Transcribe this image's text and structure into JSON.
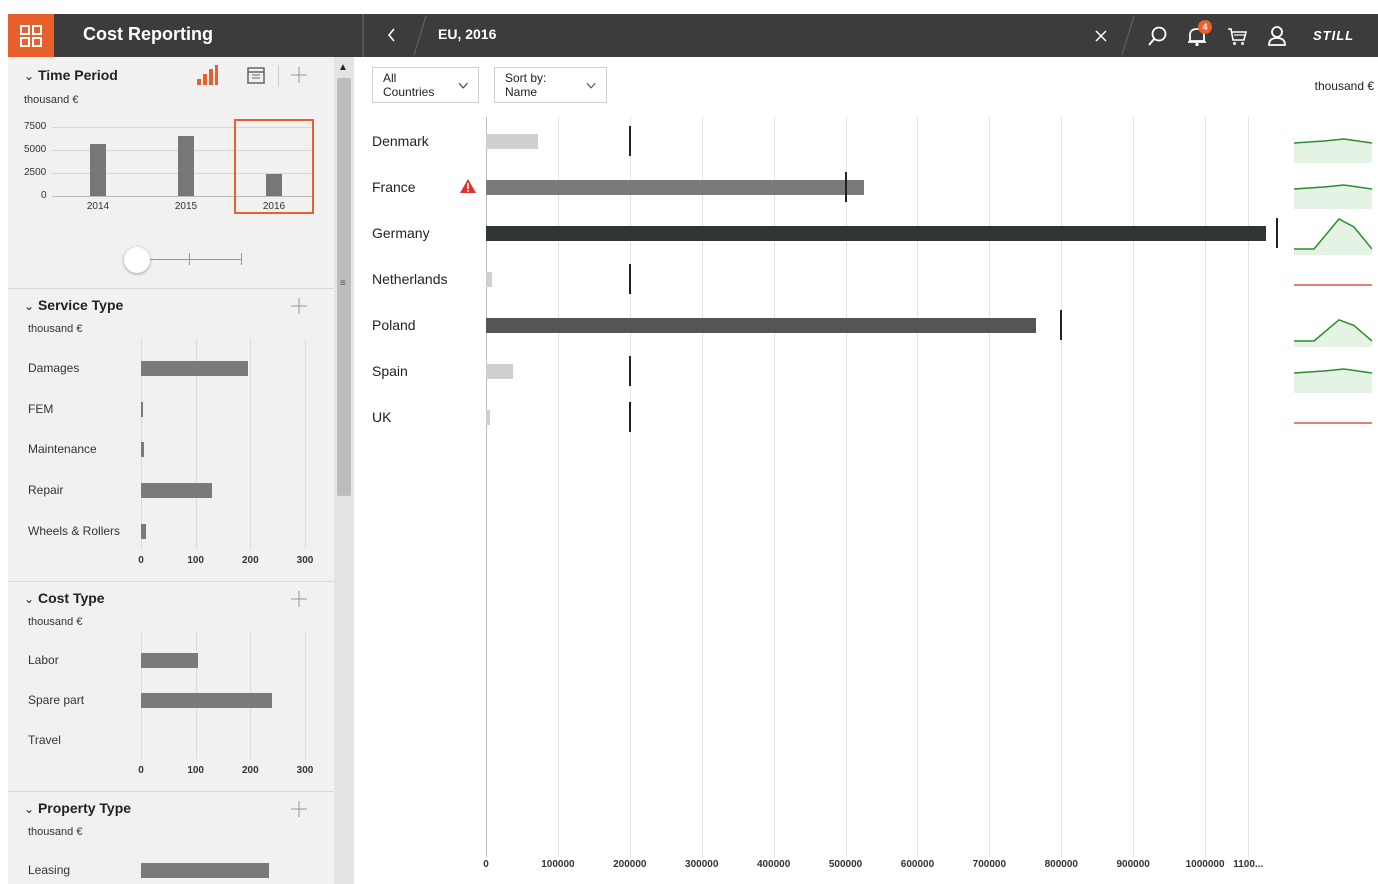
{
  "header": {
    "title": "Cost Reporting",
    "breadcrumb": "EU, 2016",
    "notification_count": "4",
    "logo": "STILL",
    "accent_color": "#e8602c"
  },
  "sidebar": {
    "time_period": {
      "title": "Time Period",
      "unit": "thousand €",
      "y_ticks": [
        "7500",
        "5000",
        "2500",
        "0"
      ],
      "chart_data": {
        "type": "bar",
        "categories": [
          "2014",
          "2015",
          "2016"
        ],
        "values": [
          5600,
          6500,
          2400
        ],
        "ylim": [
          0,
          7500
        ],
        "selected": "2016"
      }
    },
    "service_type": {
      "title": "Service Type",
      "unit": "thousand €",
      "axis_ticks": [
        "0",
        "100",
        "200",
        "300"
      ],
      "chart_data": {
        "type": "bar",
        "categories": [
          "Damages",
          "FEM",
          "Maintenance",
          "Repair",
          "Wheels & Rollers"
        ],
        "values": [
          195,
          3,
          5,
          130,
          10
        ],
        "xlim": [
          0,
          300
        ]
      }
    },
    "cost_type": {
      "title": "Cost Type",
      "unit": "thousand €",
      "axis_ticks": [
        "0",
        "100",
        "200",
        "300"
      ],
      "chart_data": {
        "type": "bar",
        "categories": [
          "Labor",
          "Spare part",
          "Travel"
        ],
        "values": [
          105,
          240,
          0
        ],
        "xlim": [
          0,
          300
        ]
      }
    },
    "property_type": {
      "title": "Property Type",
      "unit": "thousand €",
      "chart_data": {
        "type": "bar",
        "categories": [
          "Leasing"
        ],
        "values": [
          235
        ],
        "xlim": [
          0,
          300
        ]
      }
    }
  },
  "main": {
    "filter_countries": "All Countries",
    "sort_label": "Sort by: Name",
    "unit": "thousand €",
    "x_ticks": [
      "0",
      "100000",
      "200000",
      "300000",
      "400000",
      "500000",
      "600000",
      "700000",
      "800000",
      "900000",
      "1000000",
      "1100..."
    ],
    "chart_data": {
      "type": "bar",
      "categories": [
        "Denmark",
        "France",
        "Germany",
        "Netherlands",
        "Poland",
        "Spain",
        "UK"
      ],
      "values": [
        72000,
        525000,
        1085000,
        8000,
        765000,
        38000,
        5000
      ],
      "targets": [
        200000,
        500000,
        1100000,
        200000,
        800000,
        200000,
        200000
      ],
      "xlim": [
        0,
        1100000
      ],
      "warning": "France",
      "trend_colors": [
        "#2e8b2e",
        "#2e8b2e",
        "#2e8b2e",
        "#e05050",
        "#2e8b2e",
        "#2e8b2e",
        "#e05050"
      ]
    }
  }
}
